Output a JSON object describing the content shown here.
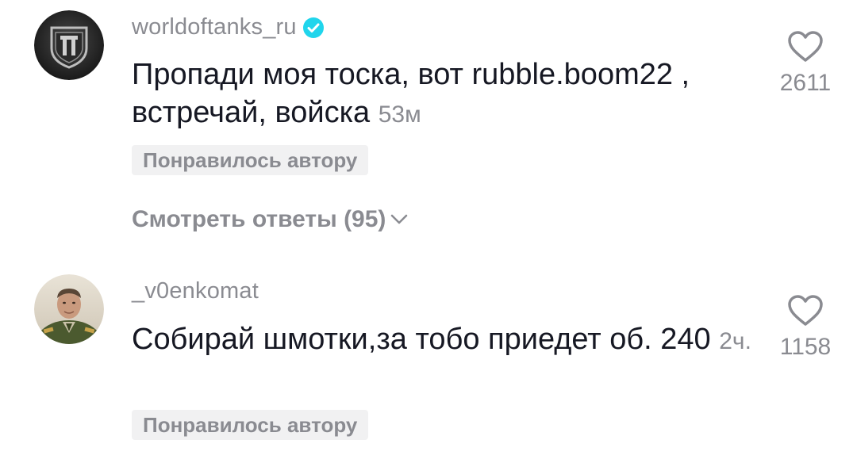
{
  "comments": [
    {
      "username": "worldoftanks_ru",
      "verified": true,
      "text": "Пропади моя тоска, вот rubble.boom22 , встречай, войска",
      "time": "53м",
      "liked_by_author": "Понравилось автору",
      "view_replies": "Смотреть ответы (95)",
      "likes": "2611"
    },
    {
      "username": "_v0enkomat",
      "verified": false,
      "text": "Собирай шмотки,за тобо приедет об. 240",
      "time": "2ч.",
      "liked_by_author": "Понравилось автору",
      "likes": "1158"
    }
  ],
  "colors": {
    "text": "#161823",
    "muted": "#8a8b91",
    "chip_bg": "#f1f1f2",
    "verified": "#20d5ec"
  }
}
